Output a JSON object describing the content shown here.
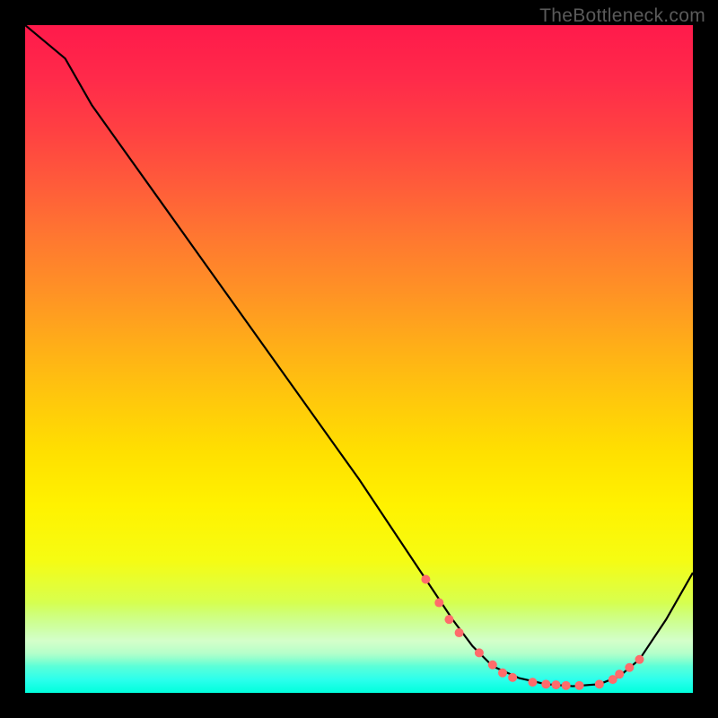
{
  "watermark": "TheBottleneck.com",
  "chart_data": {
    "type": "line",
    "title": "",
    "xlabel": "",
    "ylabel": "",
    "xlim": [
      0,
      100
    ],
    "ylim": [
      0,
      100
    ],
    "background_gradient": {
      "top": "#ff1a4b",
      "bottom": "#00ffdd",
      "stops": [
        "red",
        "orange",
        "yellow",
        "green"
      ]
    },
    "series": [
      {
        "name": "curve",
        "color": "#000000",
        "x": [
          0,
          6,
          10,
          20,
          30,
          40,
          50,
          56,
          60,
          64,
          67,
          70,
          74,
          78,
          82,
          86,
          89,
          92,
          96,
          100
        ],
        "y": [
          100,
          95,
          88,
          74,
          60,
          46,
          32,
          23,
          17,
          11,
          7,
          4,
          2.2,
          1.3,
          1.0,
          1.3,
          2.5,
          5,
          11,
          18
        ]
      }
    ],
    "markers": {
      "name": "dots",
      "color": "#ff6b6b",
      "x": [
        60,
        62,
        63.5,
        65,
        68,
        70,
        71.5,
        73,
        76,
        78,
        79.5,
        81,
        83,
        86,
        88,
        89,
        90.5,
        92
      ],
      "y": [
        17,
        13.5,
        11,
        9,
        6,
        4.2,
        3,
        2.3,
        1.6,
        1.3,
        1.2,
        1.1,
        1.1,
        1.3,
        2,
        2.8,
        3.8,
        5
      ]
    }
  }
}
